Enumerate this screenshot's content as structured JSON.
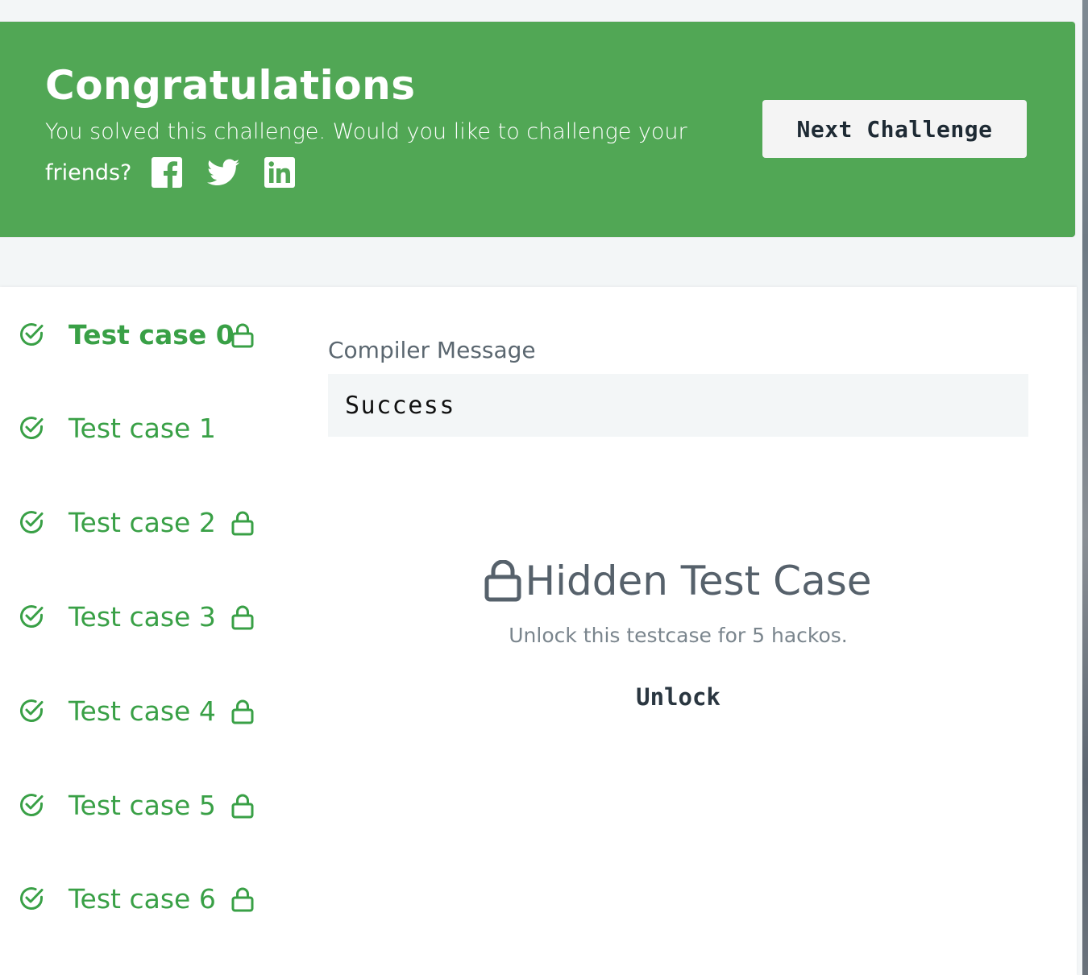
{
  "colors": {
    "banner_green": "#51a755",
    "test_green": "#39a046",
    "compiler_bg": "#f3f6f7"
  },
  "banner": {
    "title": "Congratulations",
    "message": "You solved this challenge. Would you like to challenge your",
    "share_label": "friends?",
    "share_icons": [
      "facebook-icon",
      "twitter-icon",
      "linkedin-icon"
    ],
    "next_button_label": "Next Challenge"
  },
  "testcases": [
    {
      "label": "Test case 0",
      "status": "passed",
      "locked": true,
      "active": true
    },
    {
      "label": "Test case 1",
      "status": "passed",
      "locked": false,
      "active": false
    },
    {
      "label": "Test case 2",
      "status": "passed",
      "locked": true,
      "active": false
    },
    {
      "label": "Test case 3",
      "status": "passed",
      "locked": true,
      "active": false
    },
    {
      "label": "Test case 4",
      "status": "passed",
      "locked": true,
      "active": false
    },
    {
      "label": "Test case 5",
      "status": "passed",
      "locked": true,
      "active": false
    },
    {
      "label": "Test case 6",
      "status": "passed",
      "locked": true,
      "active": false
    }
  ],
  "compiler": {
    "label": "Compiler Message",
    "output": "Success"
  },
  "hidden_testcase": {
    "title": "Hidden Test Case",
    "description": "Unlock this testcase for 5 hackos.",
    "unlock_label": "Unlock"
  }
}
